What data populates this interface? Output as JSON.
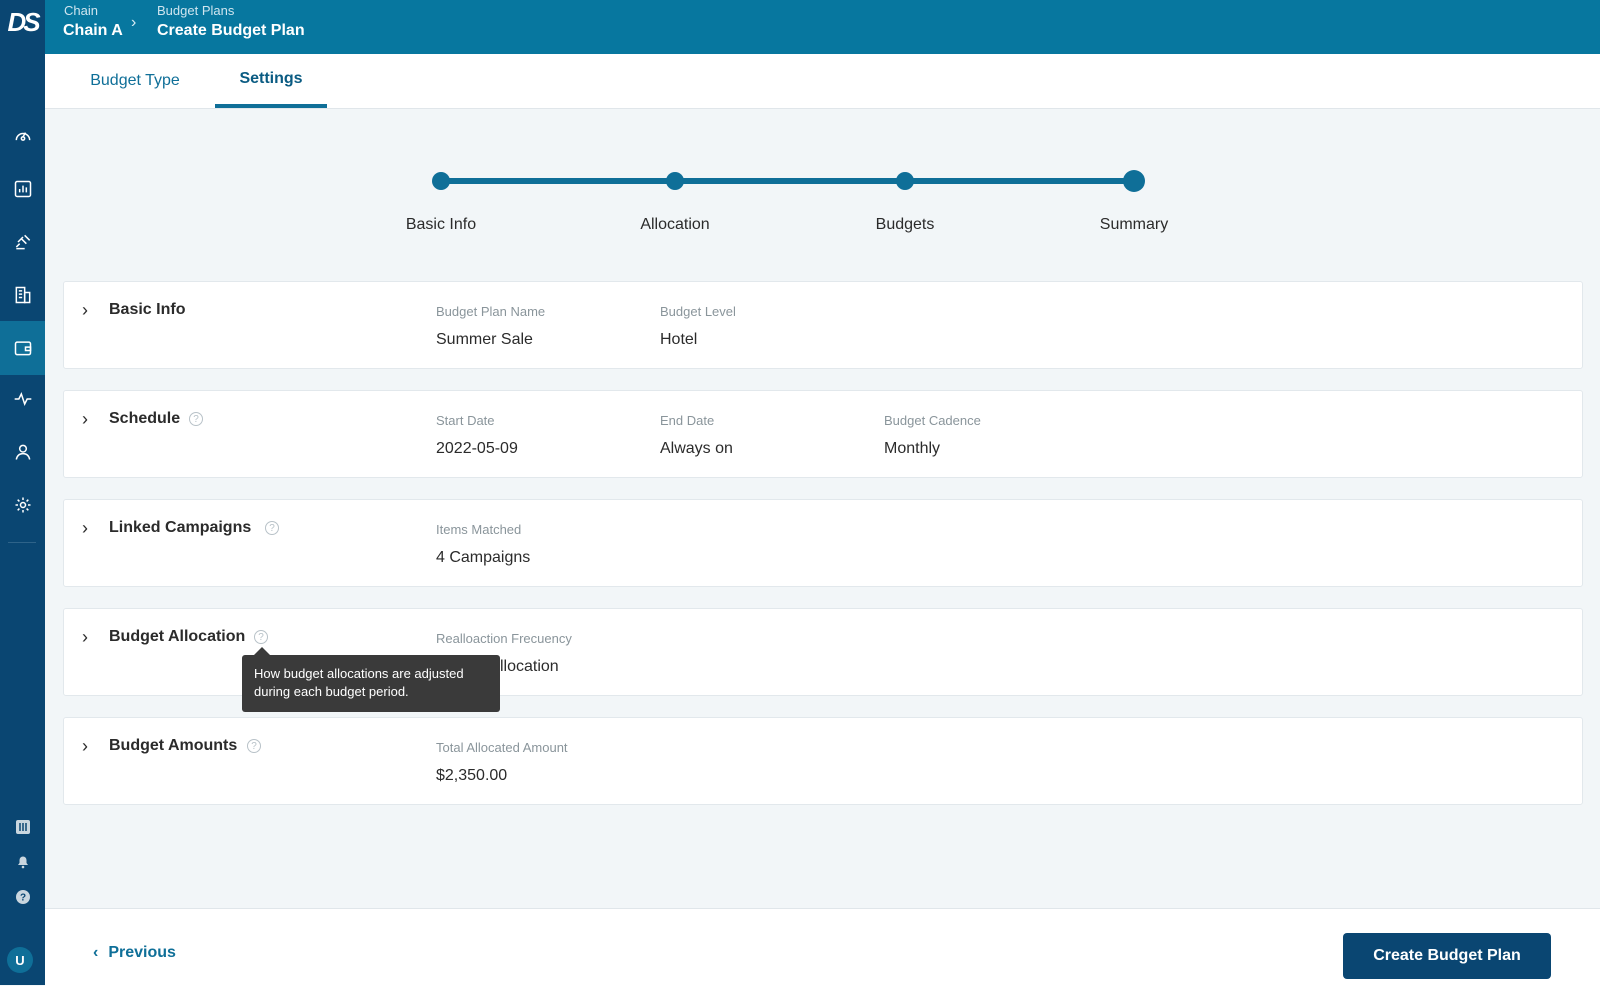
{
  "app": {
    "logo": "DS",
    "avatar_initial": "U"
  },
  "breadcrumb": {
    "level1_label": "Chain",
    "level1_value": "Chain A",
    "level2_label": "Budget Plans",
    "level2_value": "Create Budget Plan"
  },
  "tabs": [
    {
      "label": "Budget Type"
    },
    {
      "label": "Settings",
      "active": true
    }
  ],
  "stepper": {
    "steps": [
      {
        "label": "Basic Info"
      },
      {
        "label": "Allocation"
      },
      {
        "label": "Budgets"
      },
      {
        "label": "Summary",
        "current": true
      }
    ]
  },
  "sections": {
    "basic_info": {
      "title": "Basic Info",
      "fields": [
        {
          "label": "Budget Plan Name",
          "value": "Summer Sale"
        },
        {
          "label": "Budget Level",
          "value": "Hotel"
        }
      ]
    },
    "schedule": {
      "title": "Schedule",
      "fields": [
        {
          "label": "Start Date",
          "value": "2022-05-09"
        },
        {
          "label": "End Date",
          "value": "Always on"
        },
        {
          "label": "Budget Cadence",
          "value": "Monthly"
        }
      ]
    },
    "linked_campaigns": {
      "title": "Linked Campaigns",
      "fields": [
        {
          "label": "Items Matched",
          "value": "4 Campaigns"
        }
      ]
    },
    "budget_allocation": {
      "title": "Budget Allocation",
      "fields": [
        {
          "label": "Realloaction Frecuency",
          "value": "llocation"
        }
      ],
      "tooltip": "How budget allocations are adjusted during each budget period."
    },
    "budget_amounts": {
      "title": "Budget Amounts",
      "fields": [
        {
          "label": "Total Allocated Amount",
          "value": "$2,350.00"
        }
      ]
    }
  },
  "footer": {
    "previous_label": "Previous",
    "create_label": "Create Budget Plan"
  },
  "colors": {
    "header": "#07779f",
    "sidebar": "#0a4672",
    "accent": "#0f6f98",
    "primary_button": "#0a4672"
  }
}
